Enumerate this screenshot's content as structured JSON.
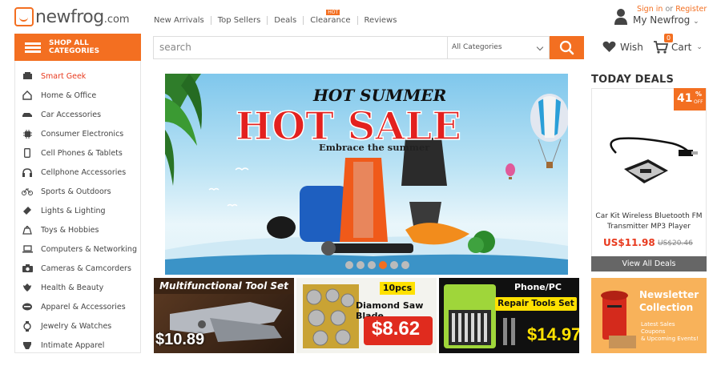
{
  "header": {
    "logo_text": "newfrog",
    "logo_tld": ".com",
    "nav": [
      "New Arrivals",
      "Top Sellers",
      "Deals",
      "Clearance",
      "Reviews"
    ],
    "hot_badge": "HOT",
    "sign_in": "Sign in",
    "or": "or",
    "register": "Register",
    "my_account": "My Newfrog"
  },
  "toolbar": {
    "shop_all_line1": "SHOP ALL",
    "shop_all_line2": "CATEGORIES",
    "search_placeholder": "search",
    "category_select": "All Categories",
    "wish_label": "Wish",
    "cart_label": "Cart",
    "cart_count": "0"
  },
  "sidebar": {
    "items": [
      {
        "label": "Smart Geek",
        "icon": "smart-geek-icon"
      },
      {
        "label": "Home & Office",
        "icon": "home-icon"
      },
      {
        "label": "Car Accessories",
        "icon": "car-icon"
      },
      {
        "label": "Consumer Electronics",
        "icon": "chip-icon"
      },
      {
        "label": "Cell Phones & Tablets",
        "icon": "phone-icon"
      },
      {
        "label": "Cellphone Accessories",
        "icon": "headphones-icon"
      },
      {
        "label": "Sports & Outdoors",
        "icon": "bicycle-icon"
      },
      {
        "label": "Lights & Lighting",
        "icon": "flashlight-icon"
      },
      {
        "label": "Toys & Hobbies",
        "icon": "toy-icon"
      },
      {
        "label": "Computers & Networking",
        "icon": "laptop-icon"
      },
      {
        "label": "Cameras & Camcorders",
        "icon": "camera-icon"
      },
      {
        "label": "Health & Beauty",
        "icon": "beauty-icon"
      },
      {
        "label": "Apparel & Accessories",
        "icon": "apparel-icon"
      },
      {
        "label": "Jewelry & Watches",
        "icon": "watch-icon"
      },
      {
        "label": "Intimate Apparel",
        "icon": "intimate-icon"
      }
    ]
  },
  "hero": {
    "line1": "HOT SUMMER",
    "line2": "HOT SALE",
    "line3": "Embrace the summer",
    "slides": 6,
    "active_slide": 4
  },
  "today_deals": {
    "title": "TODAY DEALS",
    "discount": "41",
    "discount_unit": "%",
    "discount_off": "OFF",
    "product_name": "Car Kit Wireless Bluetooth FM Transmitter MP3 Player",
    "price": "US$11.98",
    "old_price": "US$20.46",
    "button": "View All Deals"
  },
  "banners": [
    {
      "title": "Multifunctional Tool Set",
      "price": "$10.89"
    },
    {
      "tag": "10pcs",
      "title": "Diamond Saw Blade",
      "price": "$8.62"
    },
    {
      "tag": "Phone/PC",
      "title": "Repair Tools Set",
      "price": "$14.97"
    },
    {
      "title_line1": "Newsletter",
      "title_line2": "Collection",
      "sub1": "Latest Sales",
      "sub2": "Coupons",
      "sub3": "& Upcoming Events!"
    }
  ],
  "colors": {
    "accent": "#f36f21",
    "sale_red": "#e8391d"
  }
}
